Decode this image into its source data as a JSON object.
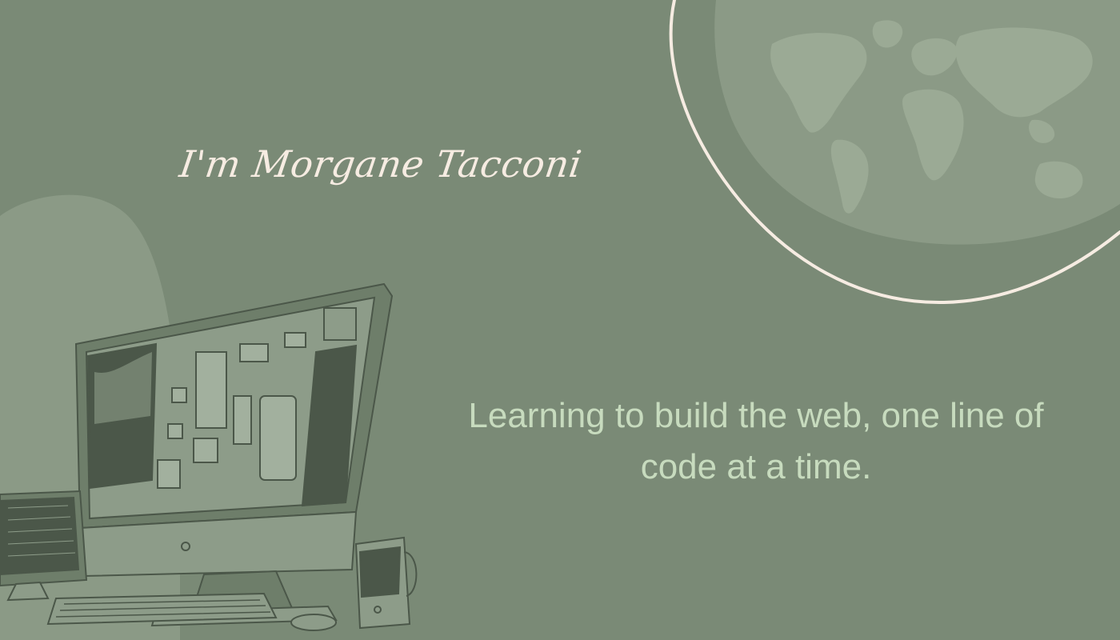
{
  "hero": {
    "name": "I'm Morgane Tacconi",
    "tagline": "Learning to build the web, one line of code at a time."
  },
  "illustrations": {
    "world_map": "world-map-icon",
    "computer": "desktop-computer-icon"
  },
  "colors": {
    "background": "#7a8a76",
    "accent_cream": "#f6ece2",
    "tagline_green": "#c7dbbe"
  }
}
